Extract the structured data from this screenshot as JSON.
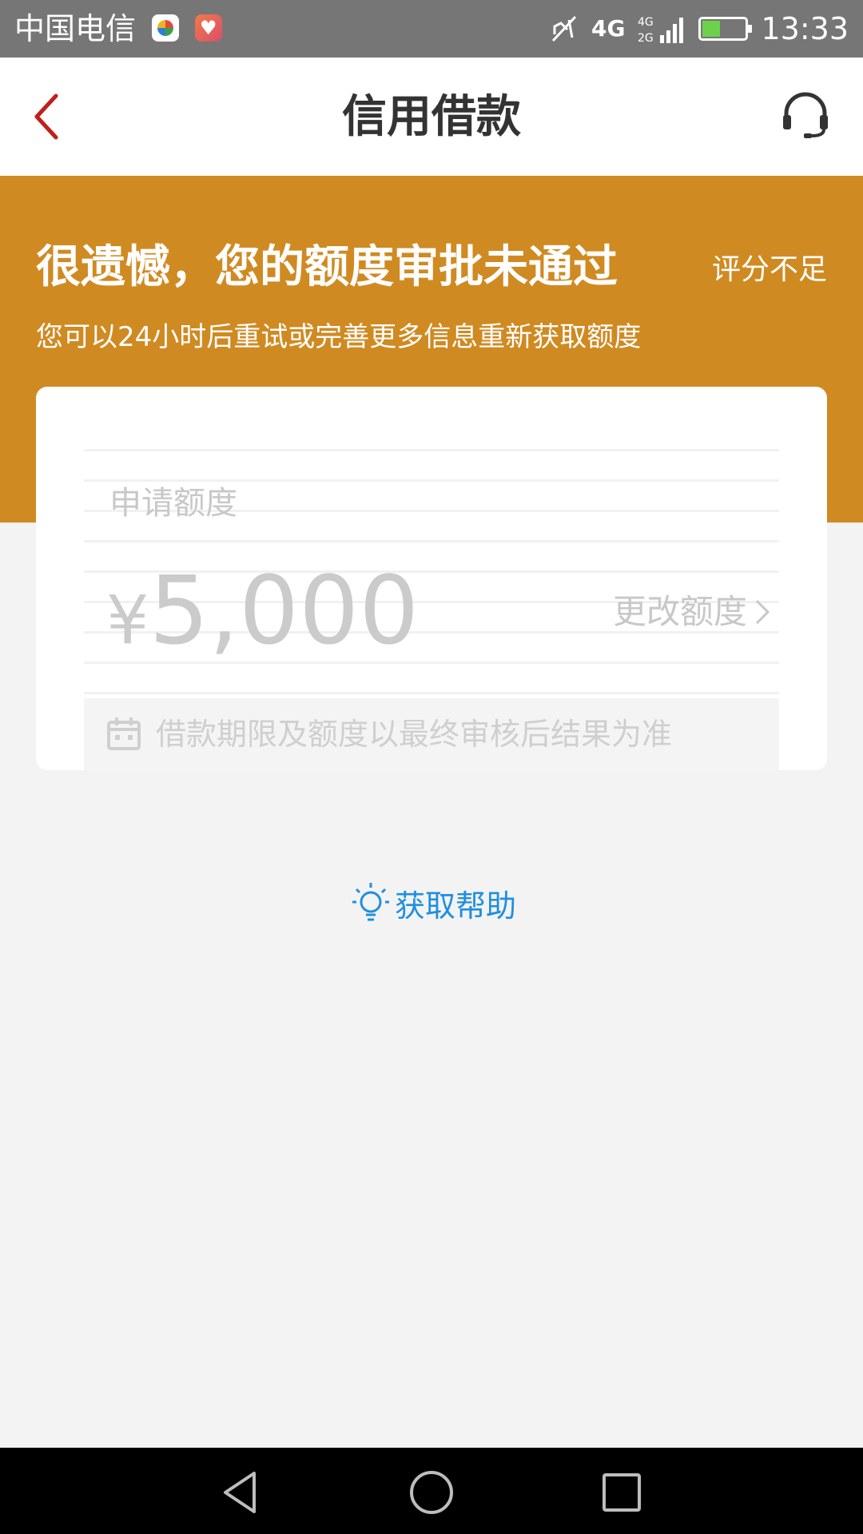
{
  "status_bar": {
    "carrier": "中国电信",
    "network": "4G",
    "time": "13:33"
  },
  "header": {
    "title": "信用借款",
    "back_icon": "chevron-left-icon",
    "support_icon": "headset-icon"
  },
  "banner": {
    "headline": "很遗憾，您的额度审批未通过",
    "reason": "评分不足",
    "subline": "您可以24小时后重试或完善更多信息重新获取额度",
    "color": "#d08a22"
  },
  "card": {
    "amount_label": "申请额度",
    "currency": "¥",
    "amount": "5,000",
    "change_label": "更改额度",
    "notice": "借款期限及额度以最终审核后结果为准"
  },
  "help": {
    "label": "获取帮助",
    "color": "#1f8fe0"
  }
}
